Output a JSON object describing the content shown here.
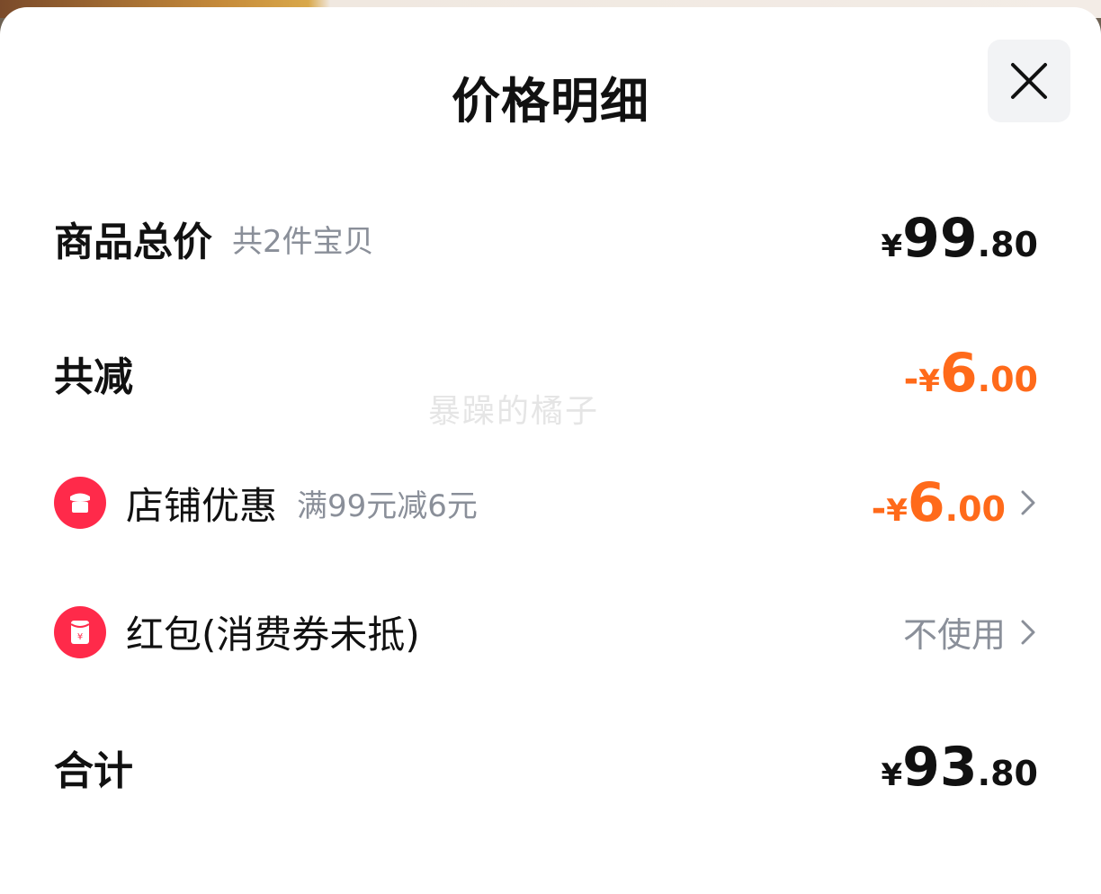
{
  "header": {
    "title": "价格明细"
  },
  "watermark": "暴躁的橘子",
  "rows": {
    "goods_total": {
      "label": "商品总价",
      "sub": "共2件宝贝",
      "symbol": "¥",
      "int": "99",
      "dec": ".80"
    },
    "total_discount": {
      "label": "共减",
      "minus": "-",
      "symbol": "¥",
      "int": "6",
      "dec": ".00"
    },
    "store_discount": {
      "label": "店铺优惠",
      "sub": "满99元减6元",
      "minus": "-",
      "symbol": "¥",
      "int": "6",
      "dec": ".00"
    },
    "red_packet": {
      "label": "红包(消费券未抵)",
      "value": "不使用"
    },
    "sum": {
      "label": "合计",
      "symbol": "¥",
      "int": "93",
      "dec": ".80"
    }
  },
  "icons": {
    "close": "close-icon",
    "store": "store-icon",
    "red_packet": "red-packet-icon",
    "chevron": "chevron-right-icon"
  },
  "colors": {
    "discount": "#ff6a1a",
    "icon_red": "#ff2a4a",
    "muted": "#8a8f99"
  }
}
